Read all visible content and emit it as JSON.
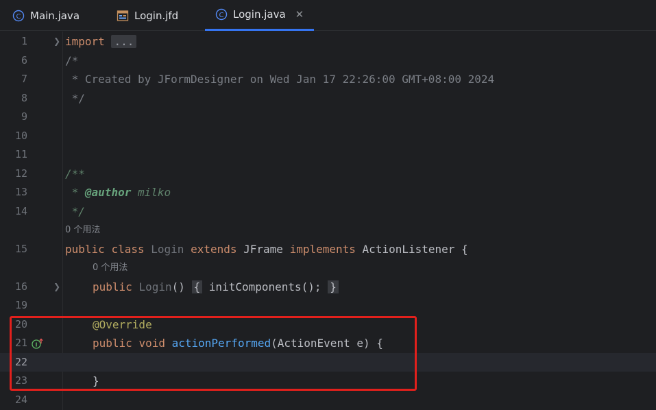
{
  "tabs": [
    {
      "label": "Main.java",
      "icon": "java-class-icon"
    },
    {
      "label": "Login.jfd",
      "icon": "form-file-icon"
    },
    {
      "label": "Login.java",
      "icon": "java-class-icon",
      "active": true,
      "close": "✕"
    }
  ],
  "editor": {
    "current_line": "22",
    "lines": [
      {
        "num": "1",
        "fold": true,
        "kw": "import",
        "folded": "..."
      },
      {
        "num": "6",
        "text": "/*"
      },
      {
        "num": "7",
        "text": " * Created by JFormDesigner on Wed Jan 17 22:26:00 GMT+08:00 2024"
      },
      {
        "num": "8",
        "text": " */"
      },
      {
        "num": "9",
        "text": ""
      },
      {
        "num": "10",
        "text": ""
      },
      {
        "num": "11",
        "text": ""
      },
      {
        "num": "12",
        "text": "/**"
      },
      {
        "num": "13",
        "text_prefix": " * ",
        "tag": "@author",
        "tag_value": " milko"
      },
      {
        "num": "14",
        "text": " */"
      },
      {
        "usage_hint": "0 个用法"
      },
      {
        "num": "15",
        "k1": "public",
        "k2": "class",
        "name": "Login",
        "k3": "extends",
        "base": "JFrame",
        "k4": "implements",
        "iface": "ActionListener",
        "end": " {"
      },
      {
        "usage_hint": "0 个用法"
      },
      {
        "num": "16",
        "fold": true,
        "k1": "public",
        "name": "Login",
        "paren": "()",
        "open": "{",
        "body": "initComponents();",
        "close": "}"
      },
      {
        "num": "19",
        "text": ""
      },
      {
        "num": "20",
        "anno": "@Override"
      },
      {
        "num": "21",
        "k1": "public",
        "k2": "void",
        "method": "actionPerformed",
        "params": "(ActionEvent e) {"
      },
      {
        "num": "22",
        "text": ""
      },
      {
        "num": "23",
        "text": "}"
      },
      {
        "num": "24",
        "text": ""
      }
    ]
  }
}
